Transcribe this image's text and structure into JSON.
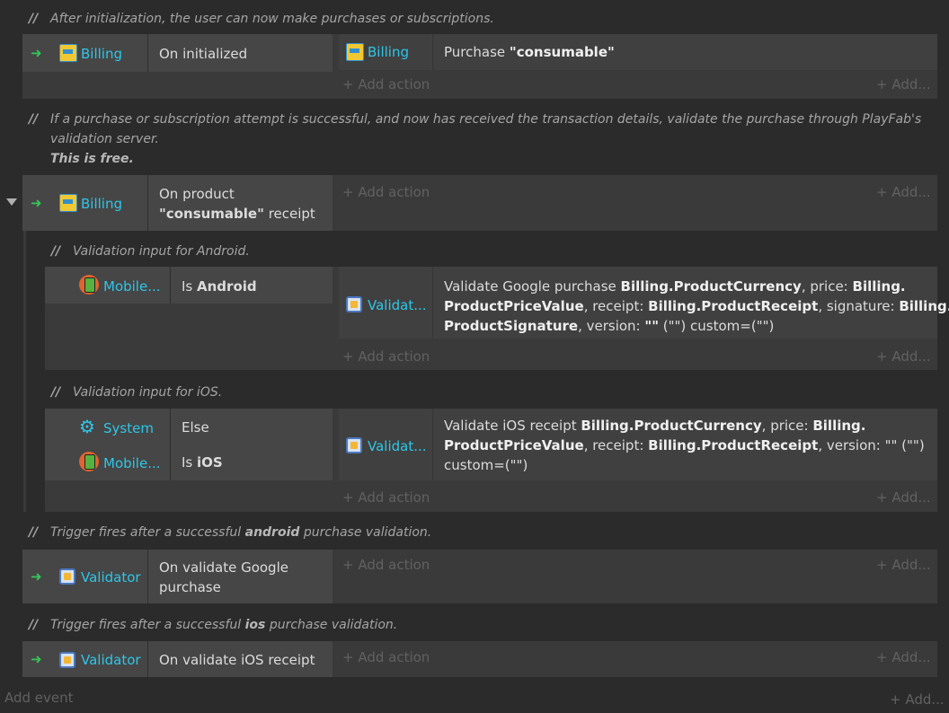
{
  "comments": {
    "c1": {
      "slashes": "//",
      "text": "After initialization, the user can now make purchases or subscriptions."
    },
    "c2": {
      "slashes": "//",
      "line1": "If a purchase or subscription attempt is successful, and now has received the transaction details, validate the purchase through PlayFab's",
      "line2": "validation server.",
      "line3": "This is free."
    },
    "c3": {
      "slashes": "//",
      "text": "Validation input for Android."
    },
    "c4": {
      "slashes": "//",
      "text": "Validation input for iOS."
    },
    "c5": {
      "slashes": "//",
      "pre": "Trigger fires after a successful ",
      "bold": "android",
      "post": " purchase validation."
    },
    "c6": {
      "slashes": "//",
      "pre": "Trigger fires after a successful ",
      "bold": "ios",
      "post": " purchase validation."
    }
  },
  "arrow": "➜",
  "add_action": "+ Add action",
  "add_more": "+ Add...",
  "add_event": "Add event",
  "events": {
    "e1": {
      "cond_object": "Billing",
      "cond_text": "On initialized",
      "act_object": "Billing",
      "act_pre": "Purchase ",
      "act_bold": "\"consumable\""
    },
    "e2": {
      "cond_object": "Billing",
      "cond_line1": "On product",
      "cond_bold": "\"consumable\"",
      "cond_post": " receipt"
    },
    "e3": {
      "cond_object": "Mobile...",
      "cond_pre": "Is ",
      "cond_bold": "Android",
      "act_object": "Validat...",
      "act_line1_pre": "Validate Google purchase ",
      "act_line1_b1": "Billing.ProductCurrency",
      "act_line1_mid": ", price: ",
      "act_line1_b2": "Billing.",
      "act_line2_b1": "ProductPriceValue",
      "act_line2_mid": ", receipt: ",
      "act_line2_b2": "Billing.ProductReceipt",
      "act_line2_mid2": ", signature: ",
      "act_line2_b3": "Billing.",
      "act_line3_b1": "ProductSignature",
      "act_line3_mid": ", version: ",
      "act_line3_b2": "\"\"",
      "act_line3_post": " (\"\") custom=(\"\")"
    },
    "e4": {
      "cond1_object": "System",
      "cond1_text": "Else",
      "cond2_object": "Mobile...",
      "cond2_pre": "Is ",
      "cond2_bold": "iOS",
      "act_object": "Validat...",
      "act_line1_pre": "Validate iOS receipt ",
      "act_line1_b1": "Billing.ProductCurrency",
      "act_line1_mid": ", price: ",
      "act_line1_b2": "Billing.",
      "act_line2_b1": "ProductPriceValue",
      "act_line2_mid": ", receipt: ",
      "act_line2_b2": "Billing.ProductReceipt",
      "act_line2_post": ", version: \"\" (\"\")",
      "act_line3": "custom=(\"\")"
    },
    "e5": {
      "cond_object": "Validator",
      "cond_line1": "On validate Google",
      "cond_line2": "purchase"
    },
    "e6": {
      "cond_object": "Validator",
      "cond_text": "On validate iOS receipt"
    }
  }
}
